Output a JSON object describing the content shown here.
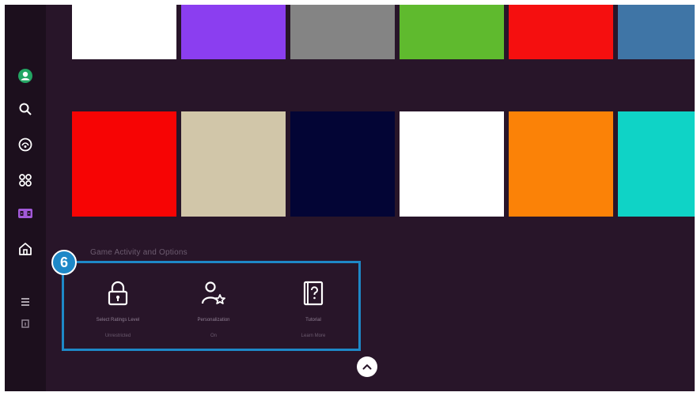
{
  "sidebar": {
    "items": [
      {
        "icon": "profile-icon",
        "active": false
      },
      {
        "icon": "search-icon",
        "active": false
      },
      {
        "icon": "ambient-icon",
        "active": false
      },
      {
        "icon": "apps-icon",
        "active": false
      },
      {
        "icon": "gaming-hub-icon",
        "active": true,
        "color": "#a259d9"
      },
      {
        "icon": "home-icon",
        "active": false
      },
      {
        "icon": "menu-icon",
        "active": false
      },
      {
        "icon": "source-icon",
        "active": false
      }
    ]
  },
  "tile_rows": [
    {
      "colors": [
        "#ffffff",
        "#8b3ef0",
        "#848484",
        "#5fba2e",
        "#f50f0f",
        "#3f75a6"
      ]
    },
    {
      "colors": [
        "#f70404",
        "#d1c6a9",
        "#030535",
        "#ffffff",
        "#fb8207",
        "#0fd3c6"
      ]
    }
  ],
  "game_options": {
    "section_title": "Game Activity and Options",
    "badge": "6",
    "accent_color": "#1e88c7",
    "items": [
      {
        "icon": "lock-icon",
        "label": "Select Ratings Level",
        "value": "Unrestricted"
      },
      {
        "icon": "personalization-icon",
        "label": "Personalization",
        "value": "On"
      },
      {
        "icon": "tutorial-icon",
        "label": "Tutorial",
        "value": "Learn More"
      }
    ]
  },
  "scroll_up": {
    "icon": "chevron-up-icon"
  }
}
